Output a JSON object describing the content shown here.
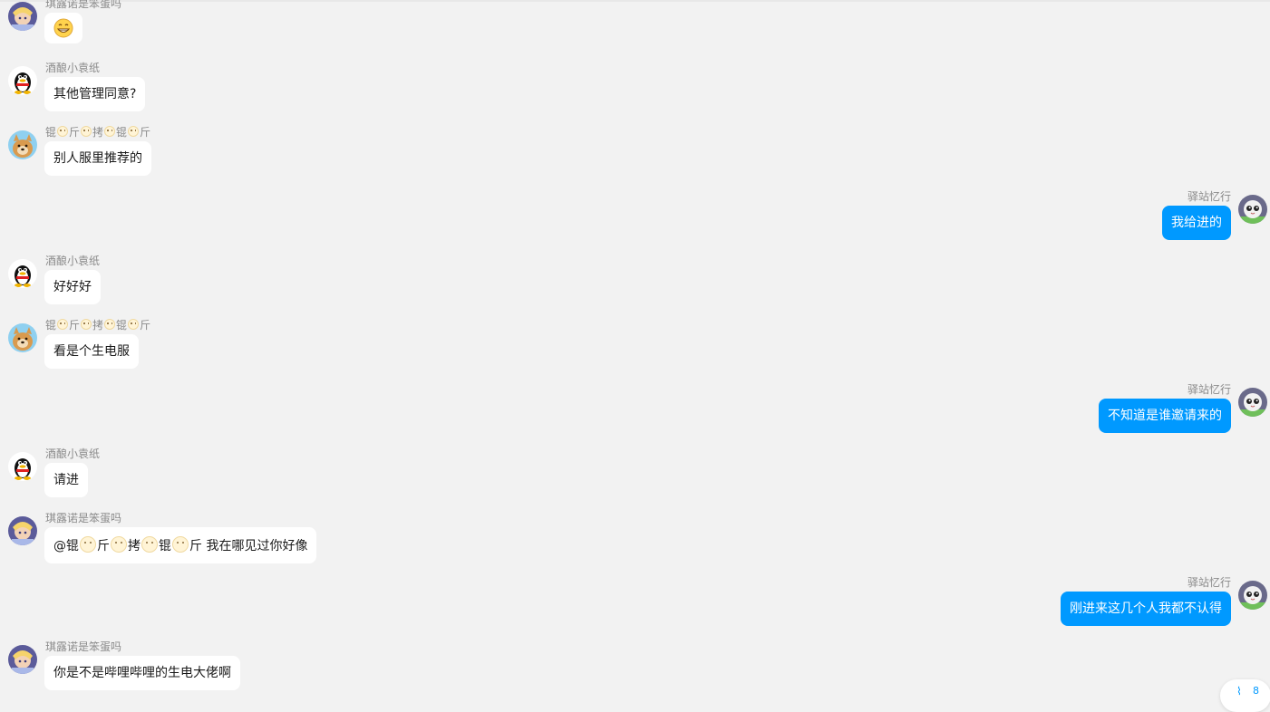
{
  "messages": [
    {
      "name": "琪露诺是笨蛋吗",
      "text": "",
      "emoji": "grin-emoji"
    },
    {
      "name": "酒酿小袁纸",
      "text": "其他管理同意?"
    },
    {
      "name": "锟",
      "text": "别人服里推荐的"
    },
    {
      "name": "驿站忆行",
      "text": "我给进的"
    },
    {
      "name": "酒酿小袁纸",
      "text": "好好好"
    },
    {
      "name": "锟",
      "text": "看是个生电服"
    },
    {
      "name": "驿站忆行",
      "text": "不知道是谁邀请来的"
    },
    {
      "name": "酒酿小袁纸",
      "text": "请进"
    },
    {
      "name": "琪露诺是笨蛋吗",
      "text": "我在哪见过你好像"
    },
    {
      "name": "驿站忆行",
      "text": "刚进来这几个人我都不认得"
    },
    {
      "name": "琪露诺是笨蛋吗",
      "text": "你是不是哔哩哔哩的生电大佬啊"
    }
  ],
  "nick_parts": [
    "锟",
    "斤",
    "拷",
    "锟",
    "斤"
  ],
  "mention_prefix": "@",
  "scroll_button": {
    "count": "8",
    "icon": "double-chevron-down-icon"
  },
  "colors": {
    "background": "#f2f2f2",
    "bubble_self": "#0099ff",
    "bubble_other": "#ffffff",
    "name_text": "#8a8a8a"
  }
}
